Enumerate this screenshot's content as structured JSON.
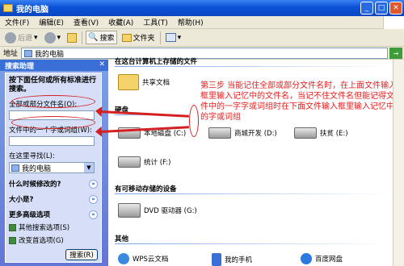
{
  "window": {
    "title": "我的电脑"
  },
  "menu": [
    "文件(F)",
    "编辑(E)",
    "查看(V)",
    "收藏(A)",
    "工具(T)",
    "帮助(H)"
  ],
  "toolbar": {
    "back": "后退",
    "search": "搜索",
    "folders": "文件夹"
  },
  "address": {
    "label": "地址",
    "value": "我的电脑"
  },
  "search_pane": {
    "title": "搜索助理",
    "heading": "按下面任何或所有标准进行搜索。",
    "name_label": "全部或部分文件名(O):",
    "word_label": "文件中的一个字或词组(W):",
    "look_in_label": "在这里寻找(L):",
    "look_in_value": "我的电脑",
    "when_label": "什么时候修改的?",
    "size_label": "大小是?",
    "advanced_label": "更多高级选项",
    "other_option": "其他搜索选项(S)",
    "pref_option": "改变首选项(G)",
    "search_button": "搜索(R)"
  },
  "sections": {
    "stored": "在这台计算机上存储的文件",
    "disks": "硬盘",
    "removable": "有可移动存储的设备",
    "other": "其他"
  },
  "items": {
    "shared_docs": "共享文档",
    "local_disk": "本地磁盘 (C:)",
    "business": "商城开发 (D:)",
    "trojan": "扶贫 (E:)",
    "stats": "统计 (F:)",
    "dvd": "DVD 驱动器 (G:)",
    "wps": "WPS云文档",
    "phone": "我的手机",
    "baidu": "百度网盘"
  },
  "annotation": "第三步   当能记住全部或部分文件名时，在上面文件输入框里输入记忆中的文件名，当记不住文件名但能记得文件中的一字字或词组时在下面文件输入框里输入记忆中的字或词组"
}
